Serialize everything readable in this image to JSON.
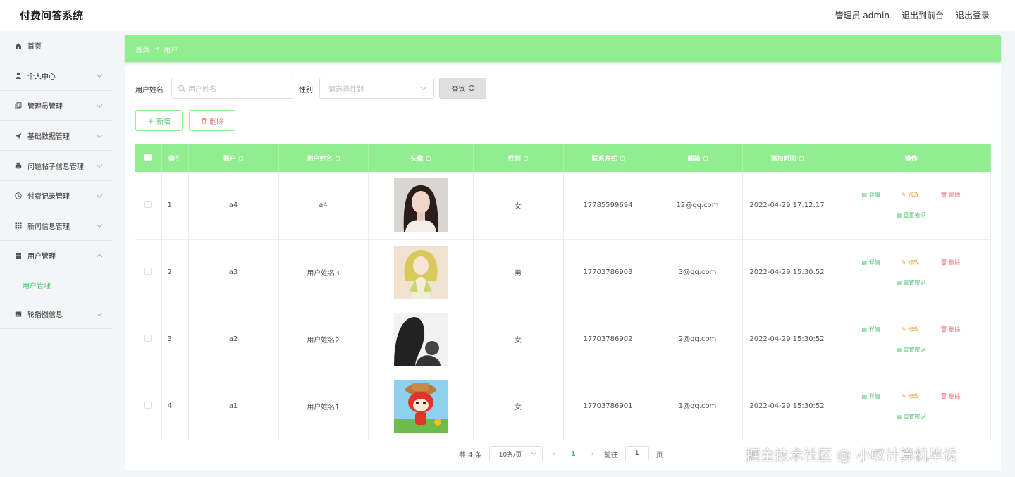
{
  "app": {
    "title": "付费问答系统"
  },
  "header": {
    "user": "管理员 admin",
    "front": "退出到前台",
    "logout": "退出登录"
  },
  "sidebar": {
    "items": [
      {
        "label": "首页",
        "icon": "home-icon"
      },
      {
        "label": "个人中心",
        "icon": "user-icon"
      },
      {
        "label": "管理员管理",
        "icon": "copy-icon"
      },
      {
        "label": "基础数据管理",
        "icon": "send-icon"
      },
      {
        "label": "问题帖子信息管理",
        "icon": "printer-icon"
      },
      {
        "label": "付费记录管理",
        "icon": "clock-icon"
      },
      {
        "label": "新闻信息管理",
        "icon": "grid-icon"
      },
      {
        "label": "用户管理",
        "icon": "box-icon"
      },
      {
        "label": "轮播图信息",
        "icon": "image-icon"
      }
    ],
    "sub_active": "用户管理"
  },
  "breadcrumb": {
    "home": "首页",
    "sep": "→",
    "current": "用户"
  },
  "filters": {
    "name_label": "用户姓名",
    "name_placeholder": "用户姓名",
    "gender_label": "性别",
    "gender_placeholder": "请选择性别",
    "query_label": "查询"
  },
  "actions": {
    "add": "＋ 新增",
    "delete": "删除"
  },
  "table": {
    "headers": [
      "索引",
      "账户",
      "用户姓名",
      "头像",
      "性别",
      "联系方式",
      "邮箱",
      "添加时间",
      "操作"
    ],
    "rows": [
      {
        "index": "1",
        "account": "a4",
        "name": "a4",
        "gender": "女",
        "phone": "17785599694",
        "email": "12@qq.com",
        "time": "2022-04-29 17:12:17"
      },
      {
        "index": "2",
        "account": "a3",
        "name": "用户姓名3",
        "gender": "男",
        "phone": "17703786903",
        "email": "3@qq.com",
        "time": "2022-04-29 15:30:52"
      },
      {
        "index": "3",
        "account": "a2",
        "name": "用户姓名2",
        "gender": "女",
        "phone": "17703786902",
        "email": "2@qq.com",
        "time": "2022-04-29 15:30:52"
      },
      {
        "index": "4",
        "account": "a1",
        "name": "用户姓名1",
        "gender": "女",
        "phone": "17703786901",
        "email": "1@qq.com",
        "time": "2022-04-29 15:30:52"
      }
    ],
    "ops": {
      "view": "详情",
      "edit": "修改",
      "delete": "删除",
      "reset": "重置密码"
    }
  },
  "pagination": {
    "total": "共 4 条",
    "size": "10条/页",
    "current": "1",
    "goto": "前往",
    "goto_value": "1",
    "page_unit": "页"
  },
  "watermark": "掘金技术社区 @ 小叹计算机毕设",
  "colors": {
    "accent": "#90ee90",
    "link": "#4bc16b",
    "warn": "#e6a23c",
    "danger": "#f56c6c"
  }
}
